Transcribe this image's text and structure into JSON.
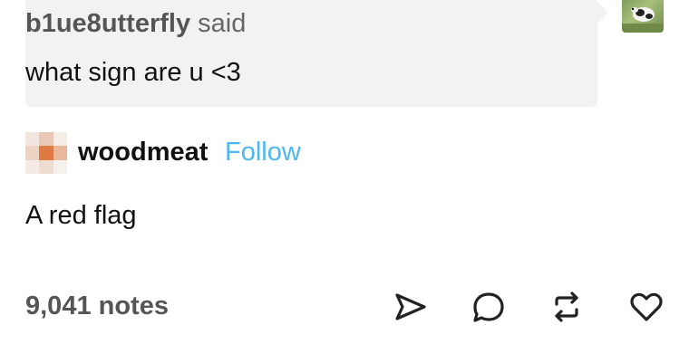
{
  "ask": {
    "asker_name": "b1ue8utterfly",
    "said_label": "said",
    "question": "what sign are u <3"
  },
  "answerer": {
    "blog_name": "woodmeat",
    "follow_label": "Follow"
  },
  "answer": {
    "text": "A red flag"
  },
  "footer": {
    "notes_count": "9,041 notes",
    "icons": [
      "share-icon",
      "reply-icon",
      "reblog-icon",
      "like-icon"
    ]
  },
  "colors": {
    "follow_link": "#4cb7f0",
    "bubble_bg": "#f2f2f2",
    "text_primary": "#111111",
    "text_secondary": "#555555"
  }
}
